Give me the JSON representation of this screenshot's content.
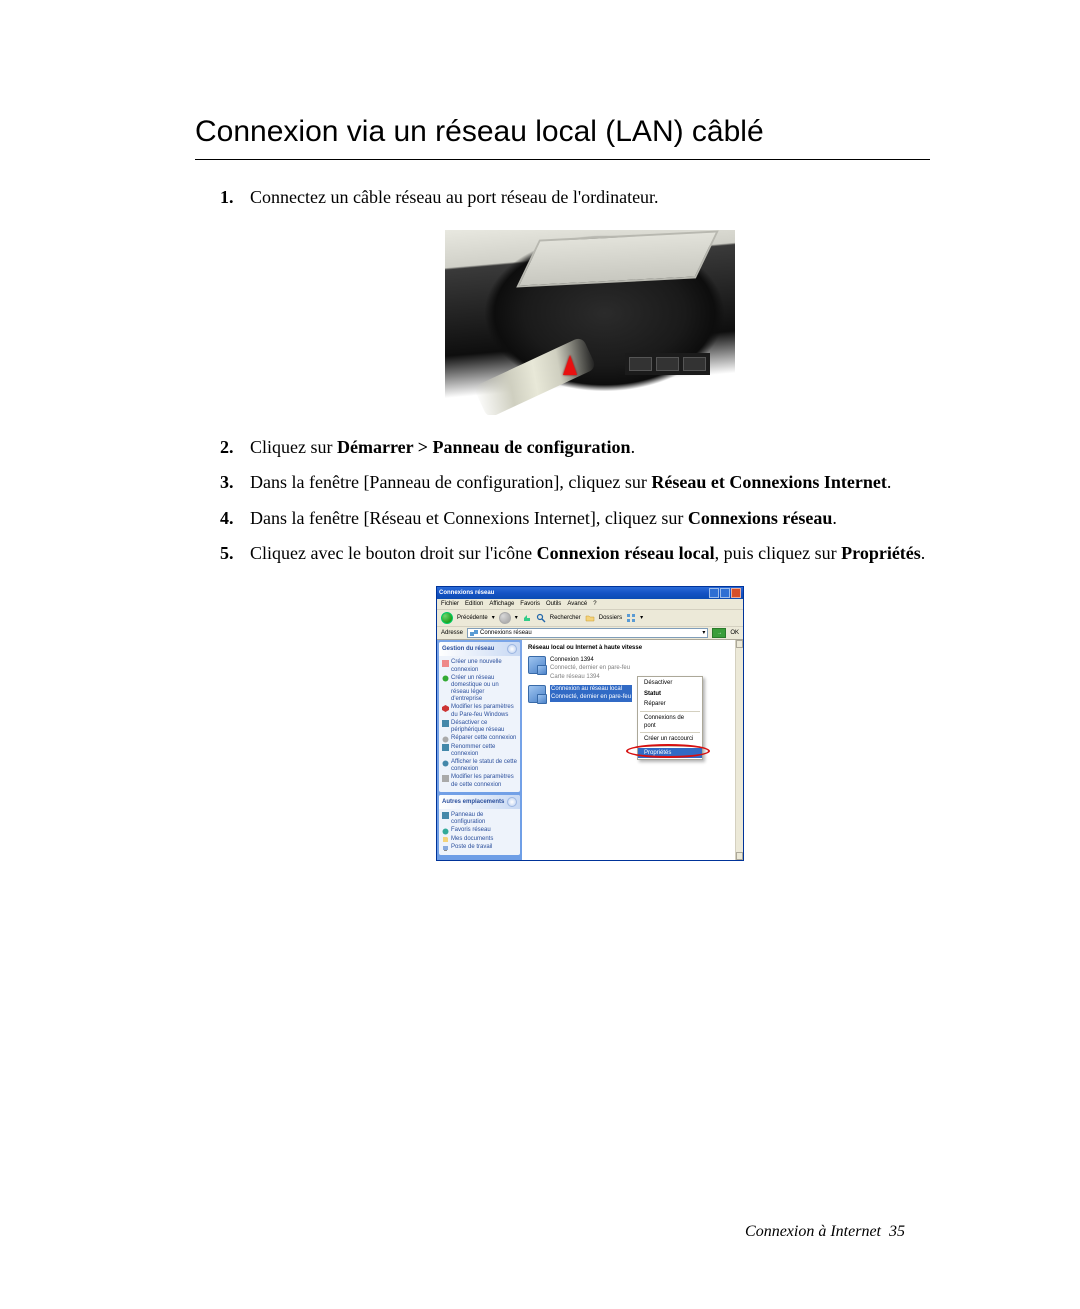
{
  "heading": "Connexion via un réseau local (LAN) câblé",
  "steps": {
    "s1": "Connectez un câble réseau au port réseau de l'ordinateur.",
    "s2_pre": "Cliquez sur ",
    "s2_bold": "Démarrer > Panneau de configuration",
    "s2_post": ".",
    "s3_pre": "Dans la fenêtre [Panneau de configuration], cliquez sur ",
    "s3_bold": "Réseau et Connexions Internet",
    "s3_post": ".",
    "s4_pre": "Dans la fenêtre [Réseau et Connexions Internet], cliquez sur ",
    "s4_bold": "Connexions réseau",
    "s4_post": ".",
    "s5a_pre": "Cliquez avec le bouton droit sur l'icône ",
    "s5a_bold": "Connexion réseau local",
    "s5a_post": ", puis cliquez sur ",
    "s5b_bold": "Propriétés",
    "s5b_post": "."
  },
  "xp": {
    "title": "Connexions réseau",
    "menubar": [
      "Fichier",
      "Edition",
      "Affichage",
      "Favoris",
      "Outils",
      "Avancé",
      "?"
    ],
    "toolbar": {
      "back": "Précédente",
      "search": "Rechercher",
      "folders": "Dossiers"
    },
    "addrbar": {
      "label": "Adresse",
      "value": "Connexions réseau",
      "go": "OK"
    },
    "sidebar": {
      "panel1": {
        "header": "Gestion du réseau",
        "links": [
          "Créer une nouvelle connexion",
          "Créer un réseau domestique ou un réseau léger d'entreprise",
          "Modifier les paramètres du Pare-feu Windows",
          "Désactiver ce périphérique réseau",
          "Réparer cette connexion",
          "Renommer cette connexion",
          "Afficher le statut de cette connexion",
          "Modifier les paramètres de cette connexion"
        ]
      },
      "panel2": {
        "header": "Autres emplacements",
        "links": [
          "Panneau de configuration",
          "Favoris réseau",
          "Mes documents",
          "Poste de travail"
        ]
      }
    },
    "main": {
      "groupHeader": "Réseau local ou Internet à haute vitesse",
      "item1": {
        "name": "Connexion 1394",
        "sub1": "Connecté, dernier en pare-feu",
        "sub2": "Carte réseau 1394"
      },
      "item2": {
        "name": "Connexion au réseau local",
        "sub1": "Connecté, dernier en pare-feu"
      }
    },
    "context": {
      "items1": [
        "Désactiver",
        "Statut",
        "Réparer"
      ],
      "items2": [
        "Connexions de pont"
      ],
      "items3": [
        "Créer un raccourci"
      ],
      "selected": "Propriétés"
    }
  },
  "footer": {
    "section": "Connexion à Internet",
    "page": "35"
  }
}
